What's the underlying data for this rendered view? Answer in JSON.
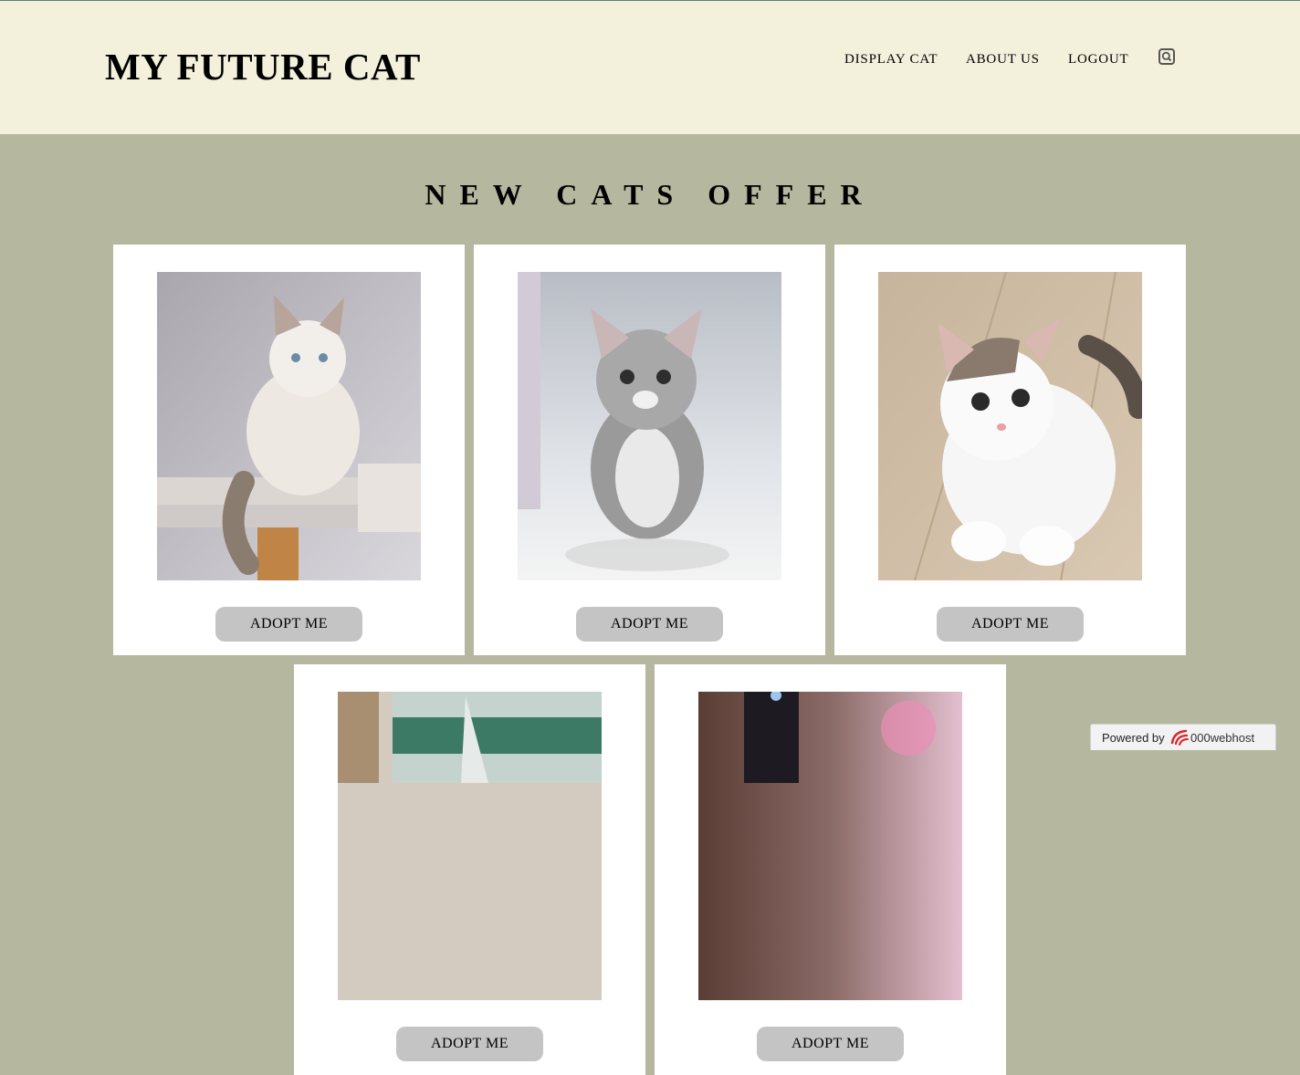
{
  "header": {
    "site_title": "MY FUTURE CAT",
    "nav": [
      {
        "label": "DISPLAY CAT"
      },
      {
        "label": "ABOUT US"
      },
      {
        "label": "LOGOUT"
      }
    ],
    "search_icon": "search-icon"
  },
  "main": {
    "section_title": "NEW CATS OFFER",
    "cards": [
      {
        "button_label": "ADOPT ME",
        "photo": "ragdoll kitten on cat tree"
      },
      {
        "button_label": "ADOPT ME",
        "photo": "tabby kitten sitting"
      },
      {
        "button_label": "ADOPT ME",
        "photo": "white kitten lying on floor"
      },
      {
        "button_label": "ADOPT ME",
        "photo": "kitten partially visible"
      },
      {
        "button_label": "ADOPT ME",
        "photo": "kitten partially visible"
      }
    ]
  },
  "badge": {
    "powered_by": "Powered by",
    "host_name": "000webhost"
  },
  "colors": {
    "page_bg": "#b5b89f",
    "header_bg": "#f3f0dc",
    "card_bg": "#ffffff",
    "button_bg": "#c4c4c4"
  }
}
